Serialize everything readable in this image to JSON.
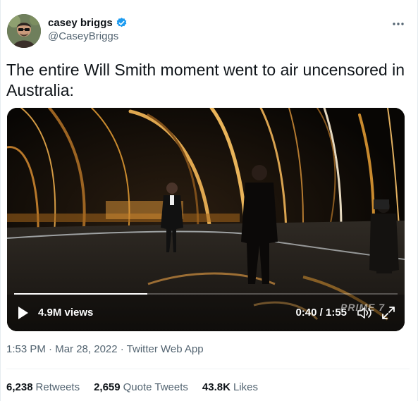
{
  "user": {
    "display_name": "casey briggs",
    "handle": "@CaseyBriggs",
    "avatar_icon": "avatar-photo",
    "verified_icon": "verified-badge-icon",
    "verified_color": "#1d9bf0"
  },
  "tweet": {
    "text": "The entire Will Smith moment went to air uncensored in Australia:"
  },
  "video": {
    "views": "4.9M views",
    "time": "0:40 / 1:55",
    "progress": 0.348,
    "watermark": "PRIME 7",
    "play_icon": "play-icon",
    "volume_icon": "volume-icon",
    "fullscreen_icon": "fullscreen-icon"
  },
  "meta": {
    "time": "1:53 PM",
    "date": "Mar 28, 2022",
    "source": "Twitter Web App",
    "sep": " · "
  },
  "stats": {
    "retweets": {
      "num": "6,238",
      "label": "Retweets"
    },
    "quotes": {
      "num": "2,659",
      "label": "Quote Tweets"
    },
    "likes": {
      "num": "43.8K",
      "label": "Likes"
    }
  },
  "colors": {
    "text": "#0f1419",
    "secondary": "#536471",
    "stage_gold": "#c98a2e"
  }
}
